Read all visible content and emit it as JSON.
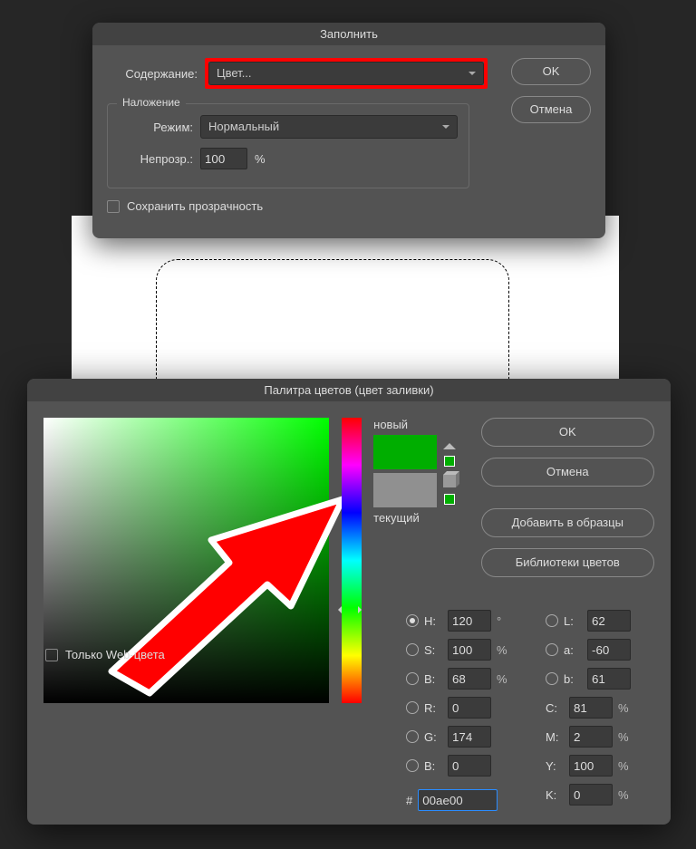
{
  "fill_dialog": {
    "title": "Заполнить",
    "content_label": "Содержание:",
    "content_value": "Цвет...",
    "overlay_title": "Наложение",
    "mode_label": "Режим:",
    "mode_value": "Нормальный",
    "opacity_label": "Непрозр.:",
    "opacity_value": "100",
    "opacity_unit": "%",
    "preserve_trans": "Сохранить прозрачность",
    "ok": "OK",
    "cancel": "Отмена"
  },
  "picker_dialog": {
    "title": "Палитра цветов (цвет заливки)",
    "web_only": "Только Web-цвета",
    "new_label": "новый",
    "current_label": "текущий",
    "ok": "OK",
    "cancel": "Отмена",
    "add_swatch": "Добавить в образцы",
    "libraries": "Библиотеки цветов",
    "hsb": {
      "h": "120",
      "s": "100",
      "b": "68"
    },
    "lab": {
      "l": "62",
      "a": "-60",
      "b": "61"
    },
    "rgb": {
      "r": "0",
      "g": "174",
      "b": "0"
    },
    "cmyk": {
      "c": "81",
      "m": "2",
      "y": "100",
      "k": "0"
    },
    "labels": {
      "H": "H:",
      "S": "S:",
      "B": "B:",
      "L": "L:",
      "a": "a:",
      "b": "b:",
      "R": "R:",
      "G": "G:",
      "Bc": "B:",
      "C": "C:",
      "M": "M:",
      "Y": "Y:",
      "K": "K:",
      "deg": "°",
      "pct": "%",
      "hash": "#"
    },
    "hex": "00ae00"
  }
}
